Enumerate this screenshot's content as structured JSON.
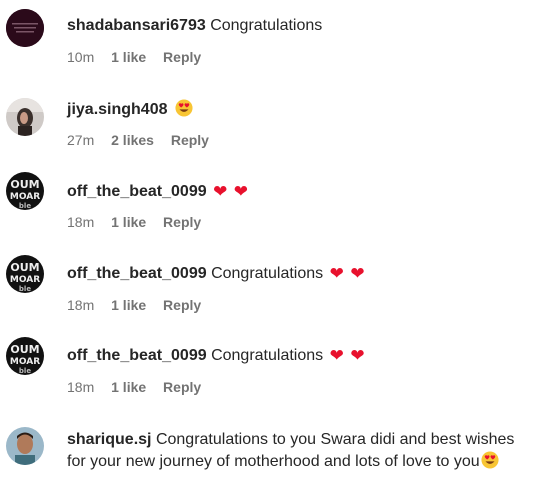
{
  "comments": [
    {
      "username": "shadabansari6793",
      "text": "Congratulations",
      "time": "10m",
      "likes": "1 like",
      "reply": "Reply",
      "avatar": "dark-text-avatar"
    },
    {
      "username": "jiya.singh408",
      "text": "",
      "time": "27m",
      "likes": "2 likes",
      "reply": "Reply",
      "emoji": "heart-eyes-emoji",
      "avatar": "photo-avatar"
    },
    {
      "username": "off_the_beat_0099",
      "text": "",
      "time": "18m",
      "likes": "1 like",
      "reply": "Reply",
      "emoji": "two-red-hearts",
      "avatar": "bw-logo-avatar"
    },
    {
      "username": "off_the_beat_0099",
      "text": "Congratulations",
      "time": "18m",
      "likes": "1 like",
      "reply": "Reply",
      "emoji": "two-red-hearts",
      "avatar": "bw-logo-avatar"
    },
    {
      "username": "off_the_beat_0099",
      "text": "Congratulations",
      "time": "18m",
      "likes": "1 like",
      "reply": "Reply",
      "emoji": "two-red-hearts",
      "avatar": "bw-logo-avatar"
    },
    {
      "username": "sharique.sj",
      "text_line1": "Congratulations to you Swara didi and best wishes",
      "text_line2": "for your new journey of motherhood and lots of love to you",
      "emoji": "heart-eyes-emoji",
      "avatar": "photo-avatar"
    }
  ],
  "colors": {
    "heart": "#e8112d",
    "meta": "#737373",
    "text": "#262626"
  }
}
